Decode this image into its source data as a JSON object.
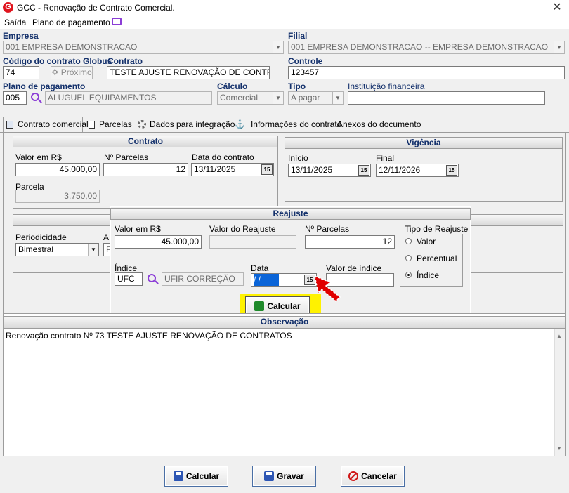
{
  "window": {
    "title": "GCC - Renovação de Contrato Comercial.",
    "logo": "G",
    "close": "✕"
  },
  "menu": {
    "items": [
      "Saída",
      "Plano de pagamento"
    ]
  },
  "form": {
    "empresa": {
      "label": "Empresa",
      "value": "001 EMPRESA DEMONSTRACAO"
    },
    "filial": {
      "label": "Filial",
      "value": "001 EMPRESA DEMONSTRACAO -- EMPRESA DEMONSTRACAO"
    },
    "codigo": {
      "label": "Código do contrato Globus",
      "value": "74",
      "next_label": "Próximo"
    },
    "contrato": {
      "label": "Contrato",
      "value": "TESTE AJUSTE RENOVAÇÃO DE CONTRATOS"
    },
    "controle": {
      "label": "Controle",
      "value": "123457"
    },
    "plano": {
      "label": "Plano de pagamento",
      "code": "005",
      "desc": "ALUGUEL EQUIPAMENTOS"
    },
    "calculo": {
      "label": "Cálculo",
      "value": "Comercial"
    },
    "tipo": {
      "label": "Tipo",
      "value": "A pagar"
    },
    "instituicao": {
      "label": "Instituição financeira",
      "value": ""
    }
  },
  "tabs": [
    {
      "label": "Contrato comercial",
      "icon": "document-icon"
    },
    {
      "label": "Parcelas",
      "icon": "page-icon"
    },
    {
      "label": "Dados para integração",
      "icon": "gears-icon"
    },
    {
      "label": "Informações do contrato",
      "icon": "anchor-icon"
    },
    {
      "label": "Anexos do documento",
      "icon": ""
    }
  ],
  "contrato_group": {
    "title": "Contrato",
    "valor_label": "Valor em R$",
    "valor": "45.000,00",
    "nparcelas_label": "Nº Parcelas",
    "nparcelas": "12",
    "data_label": "Data do contrato",
    "data": "13/11/2025",
    "parcela_label": "Parcela",
    "parcela": "3.750,00"
  },
  "vigencia_group": {
    "title": "Vigência",
    "inicio_label": "Início",
    "inicio": "13/11/2025",
    "final_label": "Final",
    "final": "12/11/2026"
  },
  "periodicidade": {
    "label": "Periodicidade",
    "value": "Bimestral",
    "cut_label": "A",
    "cut_value": "F"
  },
  "reajuste": {
    "title": "Reajuste",
    "valor_label": "Valor em R$",
    "valor": "45.000,00",
    "valor_reajuste_label": "Valor do Reajuste",
    "valor_reajuste": "",
    "nparcelas_label": "Nº Parcelas",
    "nparcelas": "12",
    "indice_label": "Índice",
    "indice_code": "UFC",
    "indice_desc": "UFIR CORREÇÃO",
    "data_label": "Data",
    "data": " / /",
    "valor_indice_label": "Valor de índice",
    "valor_indice": "",
    "tipo_label": "Tipo de Reajuste",
    "tipo_options": [
      "Valor",
      "Percentual",
      "Índice"
    ],
    "tipo_selected": "Índice",
    "calcular_label": "Calcular"
  },
  "observacao": {
    "title": "Observação",
    "text": "Renovação contrato Nº 73 TESTE AJUSTE RENOVAÇÃO DE CONTRATOS"
  },
  "footer": {
    "calcular": "Calcular",
    "gravar": "Gravar",
    "cancelar": "Cancelar"
  },
  "colors": {
    "label_blue": "#13306b",
    "highlight_yellow": "#fff200",
    "arrow_red": "#e00000"
  }
}
